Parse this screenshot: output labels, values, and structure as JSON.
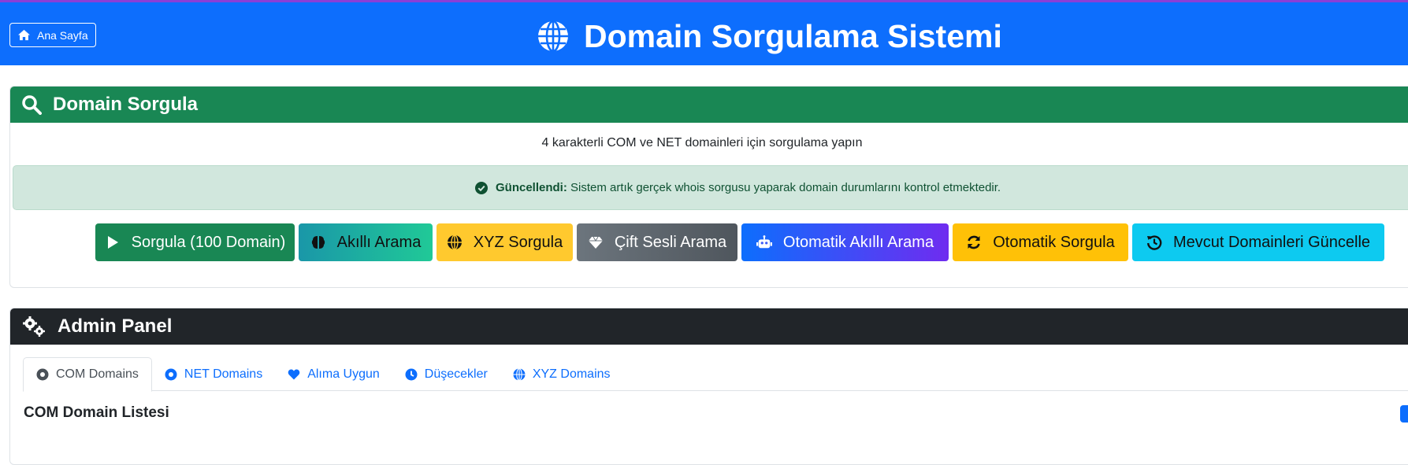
{
  "header": {
    "home_label": "Ana Sayfa",
    "title": "Domain Sorgulama Sistemi"
  },
  "query_card": {
    "title": "Domain Sorgula",
    "subtitle": "4 karakterli COM ve NET domainleri için sorgulama yapın",
    "alert_strong": "Güncellendi:",
    "alert_text": " Sistem artık gerçek whois sorgusu yaparak domain durumlarını kontrol etmektedir.",
    "buttons": [
      {
        "label": "Sorgula (100 Domain)",
        "icon": "play-icon"
      },
      {
        "label": "Akıllı Arama",
        "icon": "brain-icon"
      },
      {
        "label": "XYZ Sorgula",
        "icon": "globe-icon"
      },
      {
        "label": "Çift Sesli Arama",
        "icon": "gem-icon"
      },
      {
        "label": "Otomatik Akıllı Arama",
        "icon": "robot-icon"
      },
      {
        "label": "Otomatik Sorgula",
        "icon": "sync-icon"
      },
      {
        "label": "Mevcut Domainleri Güncelle",
        "icon": "history-icon"
      }
    ]
  },
  "admin_card": {
    "title": "Admin Panel",
    "tabs": [
      {
        "label": "COM Domains",
        "icon": "dot-circle-icon",
        "active": true
      },
      {
        "label": "NET Domains",
        "icon": "dot-circle-icon",
        "active": false
      },
      {
        "label": "Alıma Uygun",
        "icon": "heart-icon",
        "active": false
      },
      {
        "label": "Düşecekler",
        "icon": "clock-icon",
        "active": false
      },
      {
        "label": "XYZ Domains",
        "icon": "globe-icon",
        "active": false
      }
    ],
    "list_title": "COM Domain Listesi"
  },
  "colors": {
    "primary": "#0d6efd",
    "success": "#198754",
    "dark": "#212529",
    "warning": "#ffc107",
    "info": "#0dcaf0"
  }
}
